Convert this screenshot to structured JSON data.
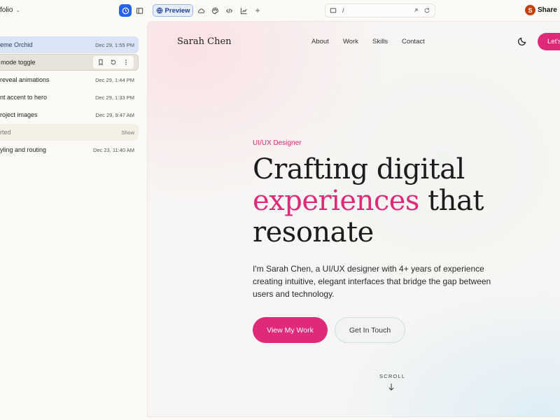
{
  "topbar": {
    "project_name": "folio",
    "preview_label": "Preview",
    "url_path": "/",
    "avatar_initial": "S",
    "share_label": "Share"
  },
  "sidebar": {
    "items": [
      {
        "title": "eme Orchid",
        "date": "Dec 29, 1:55 PM",
        "state": "active"
      },
      {
        "title": "mode toggle",
        "date": "",
        "state": "hover"
      },
      {
        "title": "reveal animations",
        "date": "Dec 29, 1:44 PM",
        "state": "normal"
      },
      {
        "title": "nt accent to hero",
        "date": "Dec 29, 1:33 PM",
        "state": "normal"
      },
      {
        "title": "roject images",
        "date": "Dec 29, 9:47 AM",
        "state": "normal"
      },
      {
        "title": "rted",
        "date": "Show",
        "state": "started"
      },
      {
        "title": "yling and routing",
        "date": "Dec 23, 11:40 AM",
        "state": "normal"
      }
    ]
  },
  "site": {
    "brand": "Sarah Chen",
    "nav": {
      "about": "About",
      "work": "Work",
      "skills": "Skills",
      "contact": "Contact"
    },
    "cta_top": "Let's",
    "eyebrow": "UI/UX Designer",
    "headline": {
      "line1": "Crafting digital",
      "accent": "experiences",
      "rest": " that",
      "line3": "resonate"
    },
    "lede": "I'm Sarah Chen, a UI/UX designer with 4+ years of experience creating intuitive, elegant interfaces that bridge the gap between users and technology.",
    "primary_button": "View My Work",
    "secondary_button": "Get In Touch",
    "scroll_label": "SCROLL"
  },
  "colors": {
    "accent": "#de2a79",
    "toolbar_blue": "#2563eb",
    "active_row": "#d9e4f7"
  }
}
